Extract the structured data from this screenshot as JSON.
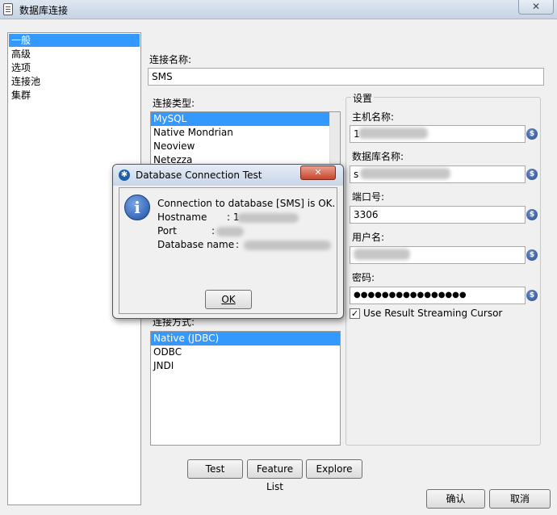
{
  "window": {
    "title": "数据库连接",
    "close_label": "✕"
  },
  "nav": {
    "items": [
      {
        "label": "一般",
        "selected": true
      },
      {
        "label": "高级"
      },
      {
        "label": "选项"
      },
      {
        "label": "连接池"
      },
      {
        "label": "集群"
      }
    ]
  },
  "form": {
    "connection_name_label": "连接名称:",
    "connection_name_value": "SMS",
    "connection_type_label": "连接类型:",
    "connection_types": [
      "MySQL",
      "Native Mondrian",
      "Neoview",
      "Netezza"
    ],
    "access_label": "连接方式:",
    "access_types": [
      "Native (JDBC)",
      "ODBC",
      "JNDI"
    ],
    "settings": {
      "legend": "设置",
      "host_label": "主机名称:",
      "host_value": "1",
      "dbname_label": "数据库名称:",
      "dbname_value": "s",
      "port_label": "端口号:",
      "port_value": "3306",
      "user_label": "用户名:",
      "user_value": "",
      "password_label": "密码:",
      "password_value": "●●●●●●●●●●●●●●●●",
      "streaming_label": "Use Result Streaming Cursor",
      "variable_icon": "$"
    }
  },
  "buttons": {
    "test": "Test",
    "feature_list": "Feature List",
    "explore": "Explore",
    "ok": "确认",
    "cancel": "取消"
  },
  "dialog": {
    "title": "Database Connection Test",
    "close_label": "✕",
    "message": "Connection to database [SMS] is OK.",
    "hostname_label": "Hostname",
    "hostname_sep": ": 1",
    "port_label": "Port",
    "port_sep": ":",
    "dbname_label": "Database name",
    "dbname_sep": ":",
    "ok_label": "OK"
  }
}
